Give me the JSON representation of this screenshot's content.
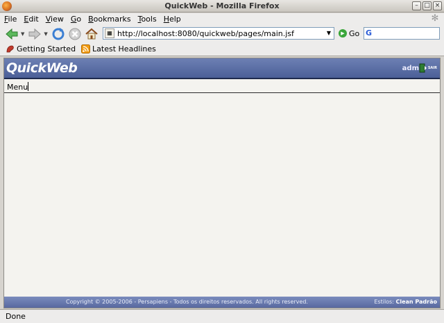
{
  "window": {
    "title": "QuickWeb - Mozilla Firefox",
    "minimize_glyph": "–",
    "maximize_glyph": "□",
    "close_glyph": "×"
  },
  "menubar": {
    "items": [
      "File",
      "Edit",
      "View",
      "Go",
      "Bookmarks",
      "Tools",
      "Help"
    ]
  },
  "navbar": {
    "url": "http://localhost:8080/quickweb/pages/main.jsf",
    "go_label": "Go",
    "search_engine_glyph": "G",
    "icons": [
      "back-icon",
      "forward-icon",
      "reload-icon",
      "stop-icon",
      "home-icon"
    ]
  },
  "bookmarks": {
    "items": [
      {
        "label": "Getting Started",
        "icon": "getting-started-icon"
      },
      {
        "label": "Latest Headlines",
        "icon": "rss-icon"
      }
    ]
  },
  "app": {
    "logo": "QuickWeb",
    "user": "adm",
    "exit_label": "SAIR",
    "menu_label": "Menu",
    "footer_copyright": "Copyright © 2005-2006 - Persapiens - Todos os direitos reservados. All rights reserved.",
    "footer_styles_label": "Estilos:",
    "footer_style_value": "Clean Padrão"
  },
  "status": {
    "text": "Done"
  },
  "colors": {
    "header_blue": "#5a6ea6",
    "footer_blue": "#6a7bb0"
  }
}
